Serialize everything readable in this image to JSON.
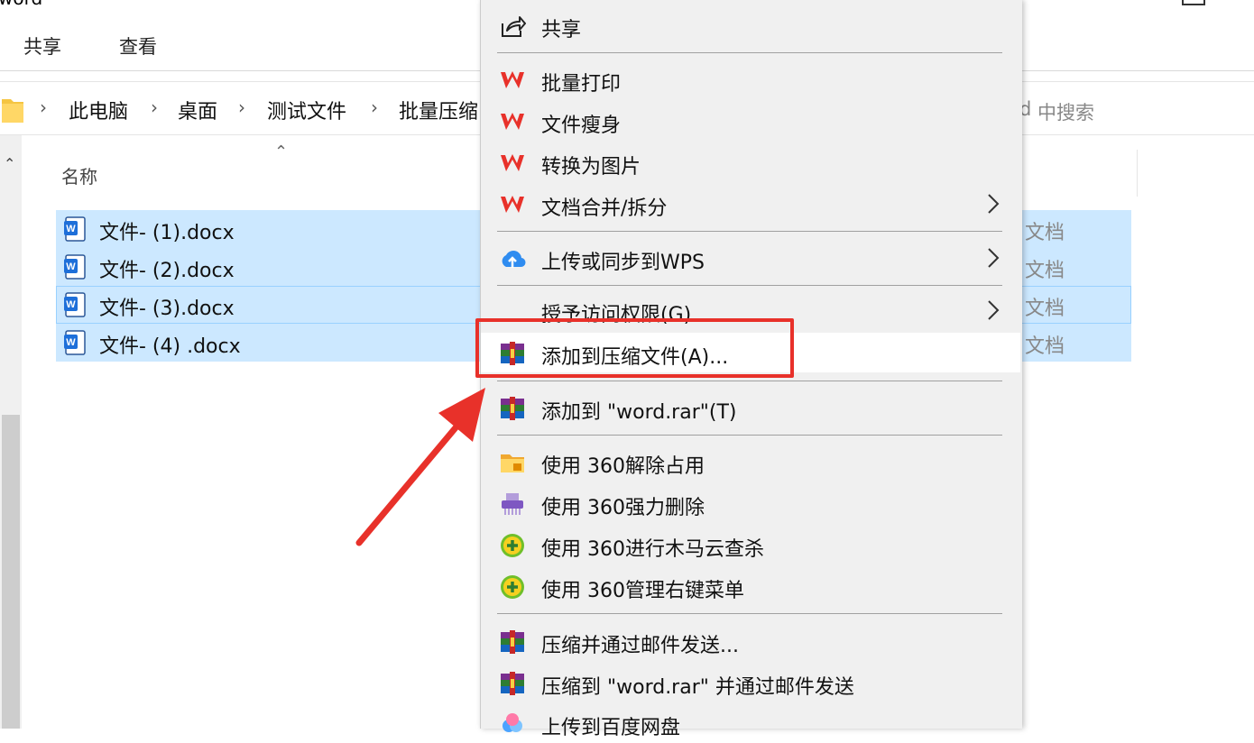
{
  "window": {
    "title": "word"
  },
  "ribbon": {
    "tabs": [
      "共享",
      "查看"
    ]
  },
  "address": {
    "crumbs": [
      "此电脑",
      "桌面",
      "测试文件",
      "批量压缩"
    ],
    "search_placeholder": "中搜索",
    "search_prefix": "d"
  },
  "list": {
    "column_name": "名称",
    "files": [
      {
        "name": "文件- (1).docx",
        "type": "文档"
      },
      {
        "name": "文件- (2).docx",
        "type": "文档"
      },
      {
        "name": "文件- (3).docx",
        "type": "文档"
      },
      {
        "name": "文件- (4) .docx",
        "type": "文档"
      }
    ]
  },
  "context_menu": {
    "share": "共享",
    "wps": [
      "批量打印",
      "文件瘦身",
      "转换为图片",
      "文档合并/拆分"
    ],
    "upload_wps": "上传或同步到WPS",
    "grant_access": "授予访问权限(G)",
    "add_archive": "添加到压缩文件(A)...",
    "add_rar": "添加到 \"word.rar\"(T)",
    "q360": [
      "使用 360解除占用",
      "使用 360强力删除",
      "使用 360进行木马云查杀",
      "使用 360管理右键菜单"
    ],
    "compress_email": "压缩并通过邮件发送...",
    "compress_rar_email": "压缩到 \"word.rar\" 并通过邮件发送",
    "baidu": "上传到百度网盘"
  },
  "colors": {
    "selection": "#cce8ff",
    "highlight_box": "#e8312a",
    "wps_red": "#e8312a"
  }
}
